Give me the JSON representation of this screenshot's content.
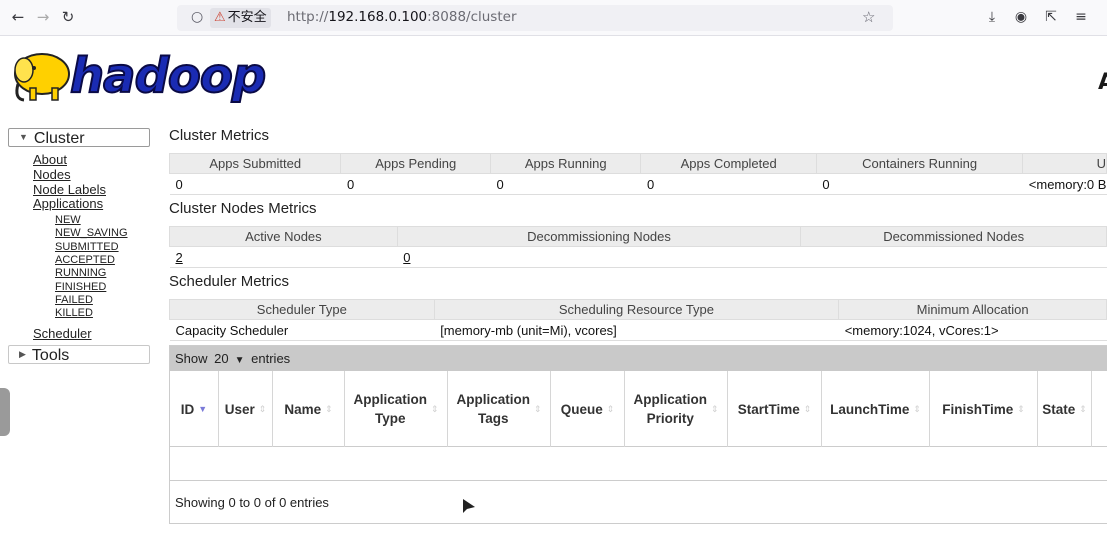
{
  "browser": {
    "url_security": "不安全",
    "url_host": "192.168.0.100",
    "url_rest": ":8088/cluster",
    "url_prefix": "http://"
  },
  "header": {
    "logo_text": "hadoop",
    "corner_letter": "A"
  },
  "nav": {
    "cluster_label": "Cluster",
    "cluster_links": [
      "About",
      "Nodes",
      "Node Labels",
      "Applications"
    ],
    "app_states": [
      "NEW",
      "NEW_SAVING",
      "SUBMITTED",
      "ACCEPTED",
      "RUNNING",
      "FINISHED",
      "FAILED",
      "KILLED"
    ],
    "scheduler_link": "Scheduler",
    "tools_label": "Tools"
  },
  "cluster_metrics": {
    "title": "Cluster Metrics",
    "headers": [
      "Apps Submitted",
      "Apps Pending",
      "Apps Running",
      "Apps Completed",
      "Containers Running",
      "U"
    ],
    "values": [
      "0",
      "0",
      "0",
      "0",
      "0",
      "<memory:0 B"
    ]
  },
  "node_metrics": {
    "title": "Cluster Nodes Metrics",
    "headers": [
      "Active Nodes",
      "Decommissioning Nodes",
      "Decommissioned Nodes"
    ],
    "values": [
      "2",
      "0",
      ""
    ]
  },
  "scheduler_metrics": {
    "title": "Scheduler Metrics",
    "headers": [
      "Scheduler Type",
      "Scheduling Resource Type",
      "Minimum Allocation"
    ],
    "values": [
      "Capacity Scheduler",
      "[memory-mb (unit=Mi), vcores]",
      "<memory:1024, vCores:1>"
    ]
  },
  "apps_table": {
    "show_label": "Show",
    "page_size": "20",
    "entries_label": "entries",
    "columns": [
      "ID",
      "User",
      "Name",
      "Application Type",
      "Application Tags",
      "Queue",
      "Application Priority",
      "StartTime",
      "LaunchTime",
      "FinishTime",
      "State"
    ],
    "info": "Showing 0 to 0 of 0 entries"
  }
}
